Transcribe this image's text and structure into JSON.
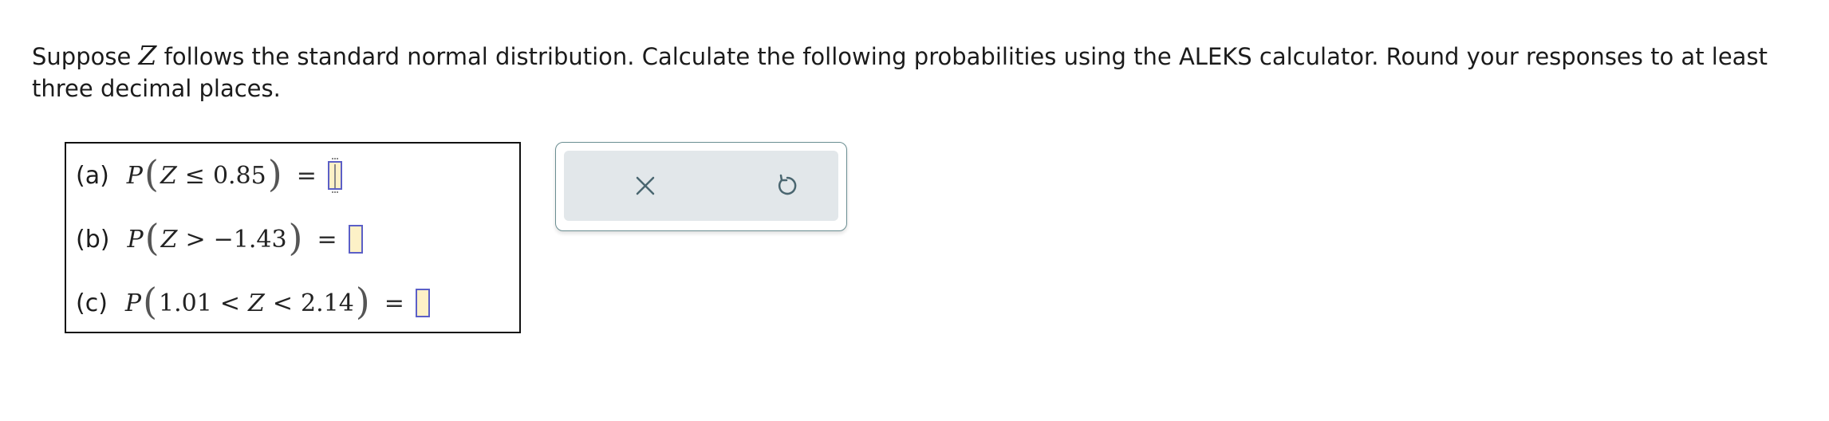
{
  "prompt": {
    "before_var": "Suppose ",
    "variable": "Z",
    "after_var": " follows the standard normal distribution. Calculate the following probabilities using the ALEKS calculator. Round your responses to at least three decimal places."
  },
  "questions": [
    {
      "label": "(a)",
      "P": "P",
      "left": "(",
      "v1": "Z",
      "op1": "≤",
      "v2": "0.85",
      "right": ")",
      "eq": "=",
      "answer": ""
    },
    {
      "label": "(b)",
      "P": "P",
      "left": "(",
      "v1": "Z",
      "op1": ">",
      "v2": "−1.43",
      "right": ")",
      "eq": "=",
      "answer": ""
    },
    {
      "label": "(c)",
      "P": "P",
      "left": "(",
      "v1": "1.01",
      "op1": "<",
      "v2": "Z",
      "op2": "<",
      "v3": "2.14",
      "right": ")",
      "eq": "=",
      "answer": ""
    }
  ],
  "tools": {
    "clear_icon": "close-icon",
    "undo_icon": "undo-icon",
    "icon_color": "#4a6670"
  },
  "colors": {
    "answer_fill": "#fdf1c7",
    "answer_border": "#5b5fc7",
    "panel_border": "#6b8e92",
    "panel_fill": "#e2e7ea"
  }
}
